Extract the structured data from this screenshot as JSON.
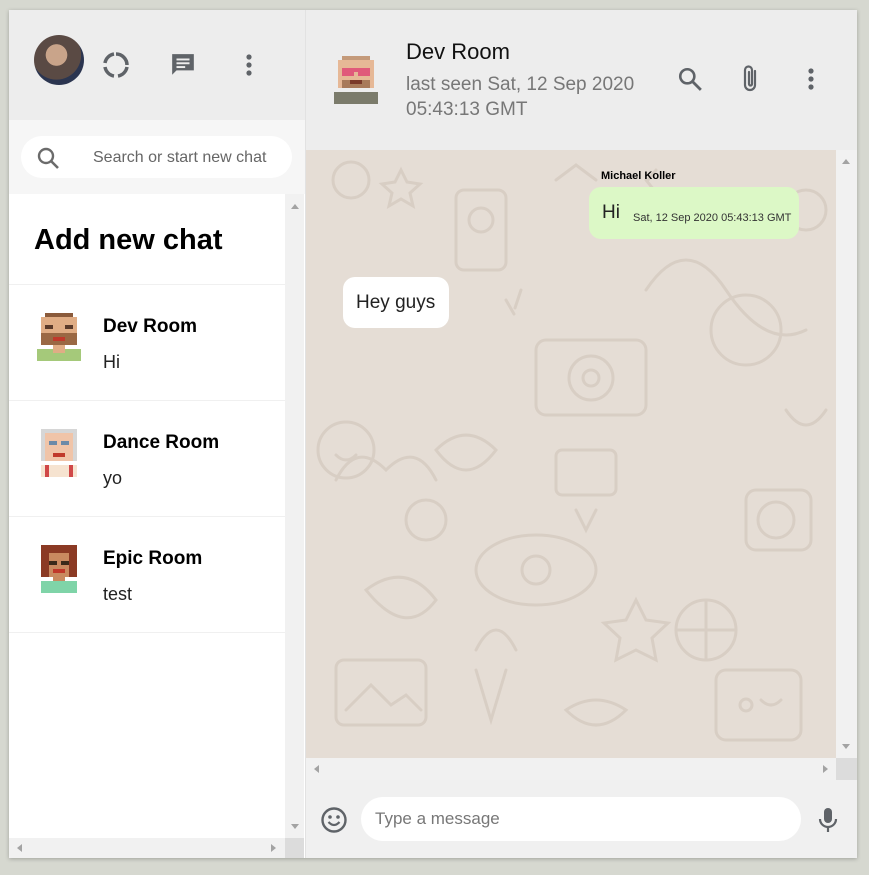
{
  "colors": {
    "header_bg": "#ededed",
    "chat_bg": "#e5ddd5",
    "bubble_out": "#dcf8c6",
    "bubble_in": "#ffffff"
  },
  "sidebar": {
    "search": {
      "placeholder": "Search or start new chat"
    },
    "add_chat_label": "Add new chat",
    "chats": [
      {
        "name": "Dev Room",
        "last_message": "Hi"
      },
      {
        "name": "Dance Room",
        "last_message": "yo"
      },
      {
        "name": "Epic Room",
        "last_message": "test"
      }
    ]
  },
  "main": {
    "header": {
      "title": "Dev Room",
      "subtitle": "last seen Sat, 12 Sep 2020 05:43:13 GMT"
    },
    "messages": [
      {
        "sender": "Michael Koller",
        "text": "Hi",
        "timestamp": "Sat, 12 Sep 2020 05:43:13 GMT"
      },
      {
        "text": "Hey guys"
      }
    ],
    "composer": {
      "placeholder": "Type a message"
    }
  }
}
